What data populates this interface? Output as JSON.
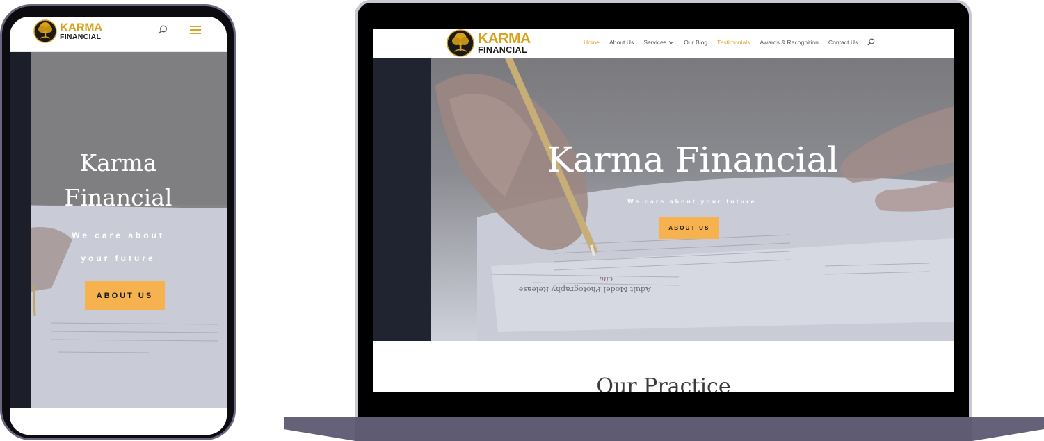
{
  "brand": {
    "name_line1": "KARMA",
    "name_line2": "FINANCIAL",
    "gold": "#d9a21c",
    "accent_button": "#f6b24f",
    "device_frame": "#6a6680"
  },
  "mobile": {
    "hero": {
      "title_line1": "Karma",
      "title_line2": "Financial",
      "subtitle_line1": "We care about",
      "subtitle_line2": "your future",
      "button_label": "ABOUT US"
    },
    "icons": [
      "search-icon",
      "hamburger-menu-icon"
    ]
  },
  "desktop": {
    "nav": [
      {
        "label": "Home",
        "state": "active"
      },
      {
        "label": "About Us",
        "state": ""
      },
      {
        "label": "Services",
        "state": "dropdown"
      },
      {
        "label": "Our Blog",
        "state": ""
      },
      {
        "label": "Testimonials",
        "state": "highlight"
      },
      {
        "label": "Awards & Recognition",
        "state": ""
      },
      {
        "label": "Contact Us",
        "state": ""
      }
    ],
    "hero": {
      "title": "Karma Financial",
      "subtitle": "We care about your future",
      "button_label": "ABOUT US"
    },
    "section_heading": "Our Practice"
  }
}
